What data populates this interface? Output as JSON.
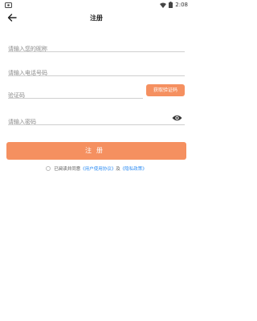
{
  "status_bar": {
    "time": "2:08"
  },
  "header": {
    "title": "注册"
  },
  "form": {
    "nickname_placeholder": "请输入您的昵称",
    "phone_placeholder": "请输入电话号码",
    "code_placeholder": "验证码",
    "get_code_label": "获取验证码",
    "password_placeholder": "请输入密码",
    "submit_label": "注册"
  },
  "agreement": {
    "prefix": "已阅读并同意",
    "user_agreement": "《用户使用协议》",
    "and": "及",
    "privacy_policy": "《隐私政策》"
  },
  "colors": {
    "accent": "#f59060",
    "link": "#2f8df3"
  }
}
